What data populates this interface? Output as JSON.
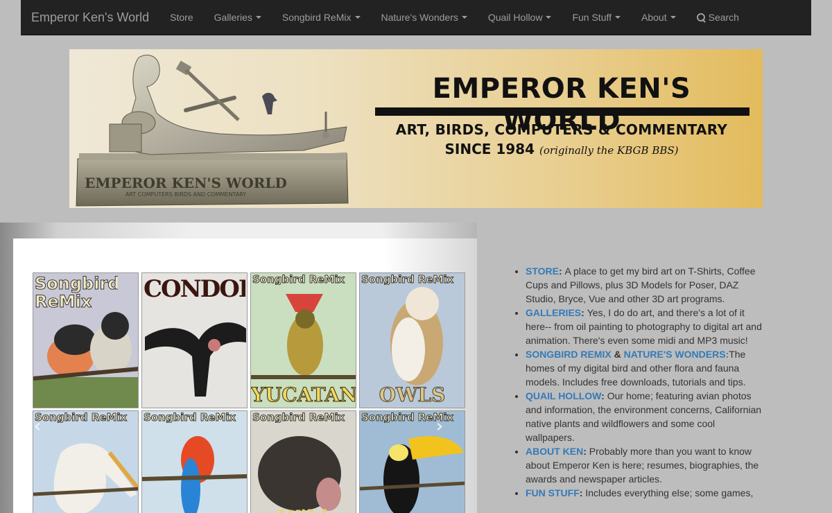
{
  "navbar": {
    "brand": "Emperor Ken's World",
    "items": [
      {
        "label": "Store",
        "dropdown": false
      },
      {
        "label": "Galleries",
        "dropdown": true
      },
      {
        "label": "Songbird ReMix",
        "dropdown": true
      },
      {
        "label": "Nature's Wonders",
        "dropdown": true
      },
      {
        "label": "Quail Hollow",
        "dropdown": true
      },
      {
        "label": "Fun Stuff",
        "dropdown": true
      },
      {
        "label": "About",
        "dropdown": true
      }
    ],
    "search_label": "Search"
  },
  "banner": {
    "title": "EMPEROR KEN'S WORLD",
    "subtitle": "ART, BIRDS, COMPUTERS & COMMENTARY",
    "since": "SINCE 1984",
    "originally": "(originally the KBGB BBS)",
    "plinth_title": "EMPEROR KEN'S WORLD",
    "plinth_sub": "ART COMPUTERS BIRDS AND COMMENTARY"
  },
  "gallery": {
    "tiles": [
      {
        "top": "Songbird ReMix",
        "bottom": "",
        "bg": "#c9c8d6",
        "label_style": "big"
      },
      {
        "top": "CONDORS",
        "bottom": "",
        "bg": "#e6e4e0",
        "label_style": "condor"
      },
      {
        "top": "Songbird ReMix",
        "bottom": "YUCATAN",
        "bg": "#c9dfc0",
        "label_style": "small"
      },
      {
        "top": "Songbird ReMix",
        "bottom": "OWLS",
        "bg": "#b9c9d9",
        "label_style": "small"
      },
      {
        "top": "Songbird ReMix",
        "bottom": "",
        "bg": "#c6d8e8",
        "label_style": "small"
      },
      {
        "top": "Songbird ReMix",
        "bottom": "",
        "bg": "#cfe0ea",
        "label_style": "small"
      },
      {
        "top": "Songbird ReMix",
        "bottom": "Wild",
        "bg": "#d9d7cd",
        "label_style": "small"
      },
      {
        "top": "Songbird ReMix",
        "bottom": "",
        "bg": "#9fbcd4",
        "label_style": "small"
      }
    ],
    "prev_glyph": "‹",
    "next_glyph": "›"
  },
  "info": {
    "items": [
      {
        "links": [
          "STORE"
        ],
        "joiner": "",
        "text": "A place to get my bird art on T-Shirts, Coffee Cups and Pillows, plus 3D Models for Poser, DAZ Studio, Bryce, Vue and other 3D art programs."
      },
      {
        "links": [
          "GALLERIES"
        ],
        "joiner": "",
        "text": "Yes, I do do art, and there's a lot of it here-- from oil painting to  photography to digital art and animation. There's even some midi and MP3 music!"
      },
      {
        "links": [
          "SONGBIRD REMIX",
          "NATURE'S WONDERS:"
        ],
        "joiner": " & ",
        "text": "The homes of my digital bird and other flora and fauna models.  Includes free downloads, tutorials and tips."
      },
      {
        "links": [
          "QUAIL HOLLOW"
        ],
        "joiner": "",
        "text": "Our home; featuring avian photos and information, the environment concerns, Californian native plants and wildflowers and some cool wallpapers."
      },
      {
        "links": [
          "ABOUT KEN"
        ],
        "joiner": "",
        "text": "Probably more than you want to know about Emperor Ken is here; resumes, biographies, the awards  and newspaper articles."
      },
      {
        "links": [
          "FUN STUFF"
        ],
        "joiner": "",
        "text": "Includes everything else; some games,"
      }
    ]
  },
  "colors": {
    "navbar_bg": "#222222",
    "navbar_text": "#9d9d9d",
    "link": "#337ab7",
    "page_bg": "#bdbdbd"
  }
}
